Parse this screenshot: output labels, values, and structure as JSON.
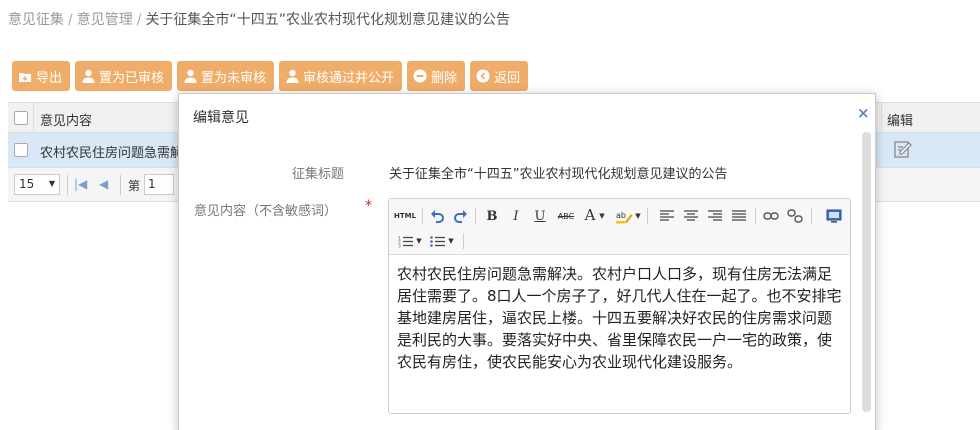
{
  "breadcrumb": {
    "item1": "意见征集",
    "item2": "意见管理",
    "sep": "/",
    "current": "关于征集全市“十四五”农业农村现代化规划意见建议的公告"
  },
  "toolbar": {
    "export": "导出",
    "set_reviewed": "置为已审核",
    "set_unreviewed": "置为未审核",
    "approve_publish": "审核通过并公开",
    "delete": "删除",
    "back": "返回"
  },
  "grid": {
    "columns": {
      "content": "意见内容",
      "edit": "编辑"
    },
    "rows": [
      {
        "content": "农村农民住房问题急需解决"
      }
    ],
    "pager": {
      "page_size": "15",
      "page_label": "第",
      "page_value": "1"
    }
  },
  "modal": {
    "title": "编辑意见",
    "close": "×",
    "field_title_label": "征集标题",
    "field_title_value": "关于征集全市“十四五”农业农村现代化规划意见建议的公告",
    "field_content_label": "意见内容（不含敏感词）",
    "required_mark": "*",
    "content_value": "农村农民住房问题急需解决。农村户口人口多，现有住房无法满足居住需要了。8口人一个房子了，好几代人住在一起了。也不安排宅基地建房居住，逼农民上楼。十四五要解决好农民的住房需求问题是利民的大事。要落实好中央、省里保障农民一户一宅的政策，使农民有房住，使农民能安心为农业现代化建设服务。"
  },
  "editor_toolbar": {
    "html": "HTML",
    "bold": "B",
    "italic": "I",
    "underline": "U",
    "strike": "ABC",
    "font_color": "A"
  },
  "colors": {
    "toolbar_button": "#f0ad6a",
    "selected_row": "#d9e8f6",
    "required": "#e02020",
    "link_blue": "#3a6fc4"
  }
}
